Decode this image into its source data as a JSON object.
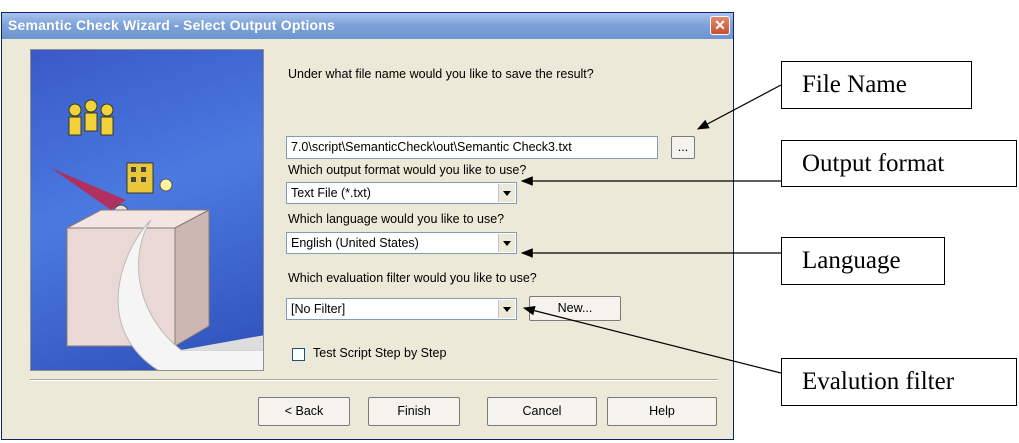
{
  "window": {
    "title": "Semantic Check Wizard - Select Output Options",
    "close_symbol": "✕"
  },
  "form": {
    "filename_question": "Under what file name would you like to save the result?",
    "filename_value": "7.0\\script\\SemanticCheck\\out\\Semantic Check3.txt",
    "browse_label": "...",
    "format_question": "Which output format would you like to use?",
    "format_value": "Text File (*.txt)",
    "language_question": "Which language would you like to use?",
    "language_value": "English (United States)",
    "filter_question": "Which evaluation filter would you like to use?",
    "filter_value": "[No Filter]",
    "new_filter_label": "New...",
    "step_checkbox_label": "Test Script Step by Step",
    "step_checkbox_checked": false
  },
  "buttons": {
    "back": "< Back",
    "finish": "Finish",
    "cancel": "Cancel",
    "help": "Help"
  },
  "callouts": {
    "file_name": "File Name",
    "output_format": "Output format",
    "language": "Language",
    "evaluation_filter": "Evalution filter"
  },
  "colors": {
    "title_bar": "#7ea2d8",
    "dialog_bg": "#ece9d8",
    "illustration_bg": "#3a59c8"
  },
  "icons": [
    "close-icon",
    "dropdown-arrow-icon",
    "printer-illustration"
  ]
}
